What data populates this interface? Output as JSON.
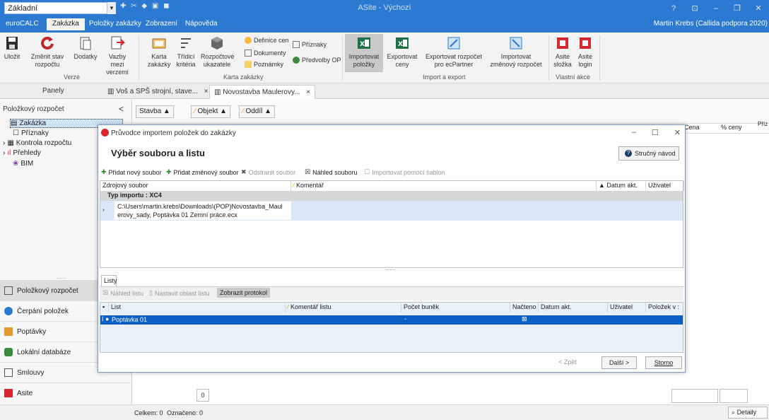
{
  "titlebar": {
    "profile": "Základní",
    "app_title": "ASite - Výchozí",
    "help": "?",
    "minimize": "–",
    "restore": "❐",
    "close": "✕"
  },
  "menu": {
    "tabs": [
      "euroCALC",
      "Zakázka",
      "Položky zakázky",
      "Zobrazení",
      "Nápověda"
    ],
    "active": "Zakázka",
    "user": "Martin Krebs (Callida podpora 2020)"
  },
  "ribbon": {
    "buttons": {
      "ulozit": "Uložit",
      "zmenit_stav_1": "Změnit stav",
      "zmenit_stav_2": "rozpočtu",
      "dodatky": "Dodatky",
      "vazby_1": "Vazby mezi",
      "vazby_2": "verzemi",
      "karta_1": "Karta",
      "karta_2": "zakázky",
      "tridici_1": "Třídicí",
      "tridici_2": "kritéria",
      "rozpoctove_1": "Rozpočtové",
      "rozpoctove_2": "ukazatele",
      "importovat_1": "Importovat",
      "importovat_2": "položky",
      "exportovat_1": "Exportovat",
      "exportovat_2": "ceny",
      "export_ec_1": "Exportovat rozpočet",
      "export_ec_2": "pro ecPartner",
      "import_zmen_1": "Importovat",
      "import_zmen_2": "změnový rozpočet",
      "asite_slozka_1": "Asite",
      "asite_slozka_2": "složka",
      "asite_login_1": "Asite",
      "asite_login_2": "login"
    },
    "small": {
      "definice_cen": "Definice cen",
      "dokumenty": "Dokumenty",
      "poznamky": "Poznámky",
      "priznaky": "Příznaky",
      "predvolby": "Předvolby OP"
    },
    "groups": {
      "verze": "Verze",
      "karta_zakazky": "Karta zakázky",
      "import_export": "Import a export",
      "vlastni_akce": "Vlastní akce"
    }
  },
  "doc_tabs": {
    "panels": "Panely",
    "tab1": "Voš a SPŠ strojní, stave...",
    "tab2": "Novostavba Maulerovy...",
    "close": "×"
  },
  "left_panel": {
    "title": "Položkový rozpočet",
    "collapse": "<",
    "tree": [
      "Zakázka",
      "Příznaky",
      "Kontrola rozpočtu",
      "Přehledy",
      "BIM"
    ],
    "dots": "......",
    "nav": [
      "Položkový rozpočet",
      "Čerpání položek",
      "Poptávky",
      "Lokální databáze",
      "Smlouvy",
      "Asite"
    ],
    "more": "•••"
  },
  "main": {
    "group_stavba": "Stavba",
    "group_objekt": "Objekt",
    "group_oddil": "Oddíl",
    "col_cena": "Cena",
    "col_pct": "% ceny",
    "col_priz": "Přízk",
    "bottom_count": "0",
    "status_celkem": "Celkem: 0",
    "status_oznaceno": "Označeno: 0",
    "detaily": "Detaily"
  },
  "dialog": {
    "title": "Průvodce importem položek do zakázky",
    "heading": "Výběr souboru a listu",
    "help_button": "Stručný návod",
    "toolbar": {
      "add_file": "Přidat nový soubor",
      "add_change": "Přidat změnový soubor",
      "remove": "Odstranit soubor",
      "preview": "Náhled souboru",
      "template_import": "Importovat pomocí šablon"
    },
    "files_grid": {
      "cols": [
        "Zdrojový soubor",
        "Komentář",
        "Datum akt.",
        "Uživatel"
      ],
      "group": "Typ importu : XC4",
      "file_line1": "C:\\Users\\martin.krebs\\Downloads\\(POP)Novostavba_Maul",
      "file_line2": "erovy_sady, Poptávka 01 Zemní práce.ecx",
      "splitter": "......"
    },
    "sheets": {
      "tab": "Listy",
      "tb_preview": "Náhled listu",
      "tb_range": "Nastavit oblast listu",
      "tb_protocol": "Zobrazit protokol",
      "cols": [
        "List",
        "Komentář listu",
        "Počet buněk",
        "Načteno",
        "Datum akt.",
        "Uživatel",
        "Položek v :"
      ],
      "row": {
        "list": "Poptávka 01",
        "pocet": "-"
      }
    },
    "buttons": {
      "back": "< Zpět",
      "next": "Další >",
      "cancel": "Storno"
    }
  },
  "colors": {
    "accent": "#2b79d0",
    "selection": "#0b5fc4",
    "excel_green": "#1e7145",
    "asite_red": "#d9262e"
  }
}
